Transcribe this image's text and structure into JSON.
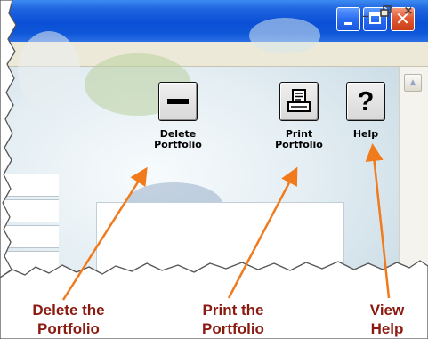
{
  "window": {
    "title_controls": [
      "minimize",
      "maximize",
      "close"
    ],
    "mdi_controls": {
      "minimize": "_",
      "restore": "🗗",
      "close": "×"
    }
  },
  "toolbar": {
    "delete_portfolio": {
      "icon": "minus-icon",
      "label_line1": "Delete",
      "label_line2": "Portfolio"
    },
    "print_portfolio": {
      "icon": "printer-icon",
      "label_line1": "Print",
      "label_line2": "Portfolio"
    },
    "help": {
      "icon": "question-mark-icon",
      "glyph": "?",
      "label": "Help"
    }
  },
  "callouts": {
    "delete": {
      "line1": "Delete the",
      "line2": "Portfolio"
    },
    "print": {
      "line1": "Print the",
      "line2": "Portfolio"
    },
    "help": {
      "line1": "View",
      "line2": "Help"
    }
  },
  "colors": {
    "titlebar_blue": "#0a4fd6",
    "close_red": "#e25a32",
    "callout_text": "#8b1a10",
    "arrow_orange": "#f07a1c"
  }
}
